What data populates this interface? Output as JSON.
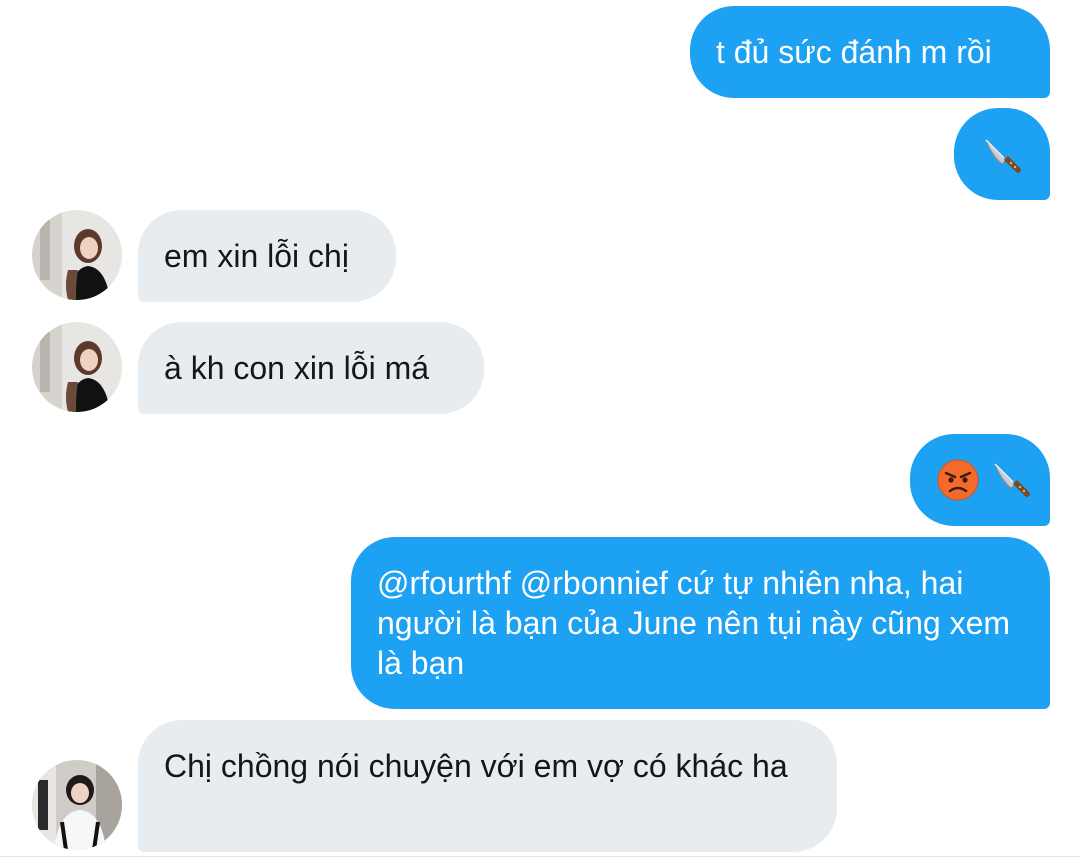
{
  "conversation": {
    "messages": [
      {
        "direction": "sent",
        "text": "t đủ sức đánh m rồi"
      },
      {
        "direction": "sent",
        "emoji": [
          "knife-emoji"
        ]
      },
      {
        "direction": "received",
        "text": "em xin lỗi chị"
      },
      {
        "direction": "received",
        "text": "à kh con xin lỗi má"
      },
      {
        "direction": "sent",
        "emoji": [
          "angry-face-emoji",
          "knife-emoji"
        ]
      },
      {
        "direction": "sent",
        "text": "@rfourthf @rbonnief cứ tự nhiên nha, hai người là bạn của June nên tụi này cũng xem là bạn"
      },
      {
        "direction": "received",
        "text": "Chị chồng nói chuyện với em vợ có khác ha"
      }
    ]
  },
  "colors": {
    "sent_bubble": "#1da1f2",
    "received_bubble": "#e6ecf0",
    "sent_text": "#ffffff",
    "received_text": "#14171a"
  }
}
